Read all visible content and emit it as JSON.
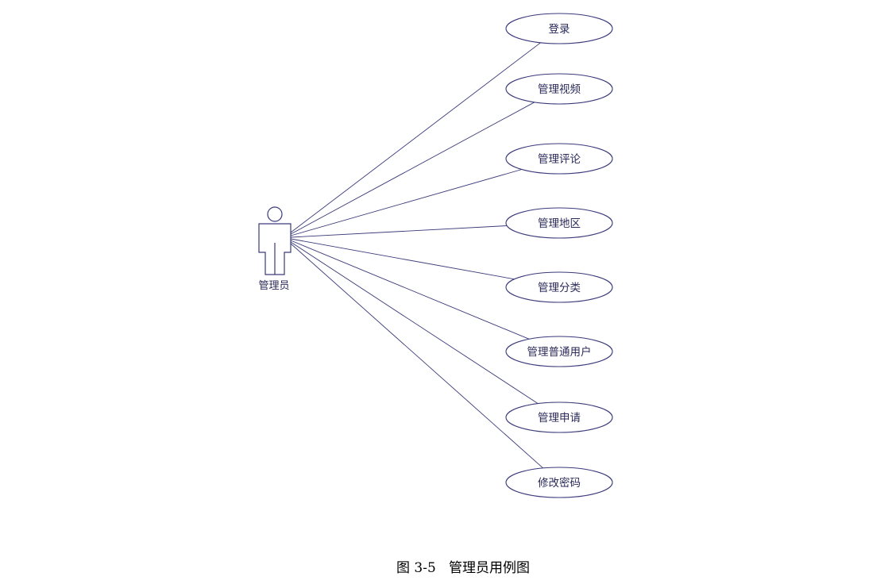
{
  "diagram": {
    "actor": {
      "label": "管理员",
      "icon": "stick-figure-actor-icon"
    },
    "use_cases": [
      {
        "id": "login",
        "label": "登录"
      },
      {
        "id": "manage-videos",
        "label": "管理视频"
      },
      {
        "id": "manage-comments",
        "label": "管理评论"
      },
      {
        "id": "manage-regions",
        "label": "管理地区"
      },
      {
        "id": "manage-categories",
        "label": "管理分类"
      },
      {
        "id": "manage-users",
        "label": "管理普通用户"
      },
      {
        "id": "manage-applications",
        "label": "管理申请"
      },
      {
        "id": "change-password",
        "label": "修改密码"
      }
    ],
    "colors": {
      "stroke": "#3a3a7a",
      "text": "#2a2a5a"
    }
  },
  "caption": {
    "number": "图 3-5",
    "title": "管理员用例图"
  }
}
